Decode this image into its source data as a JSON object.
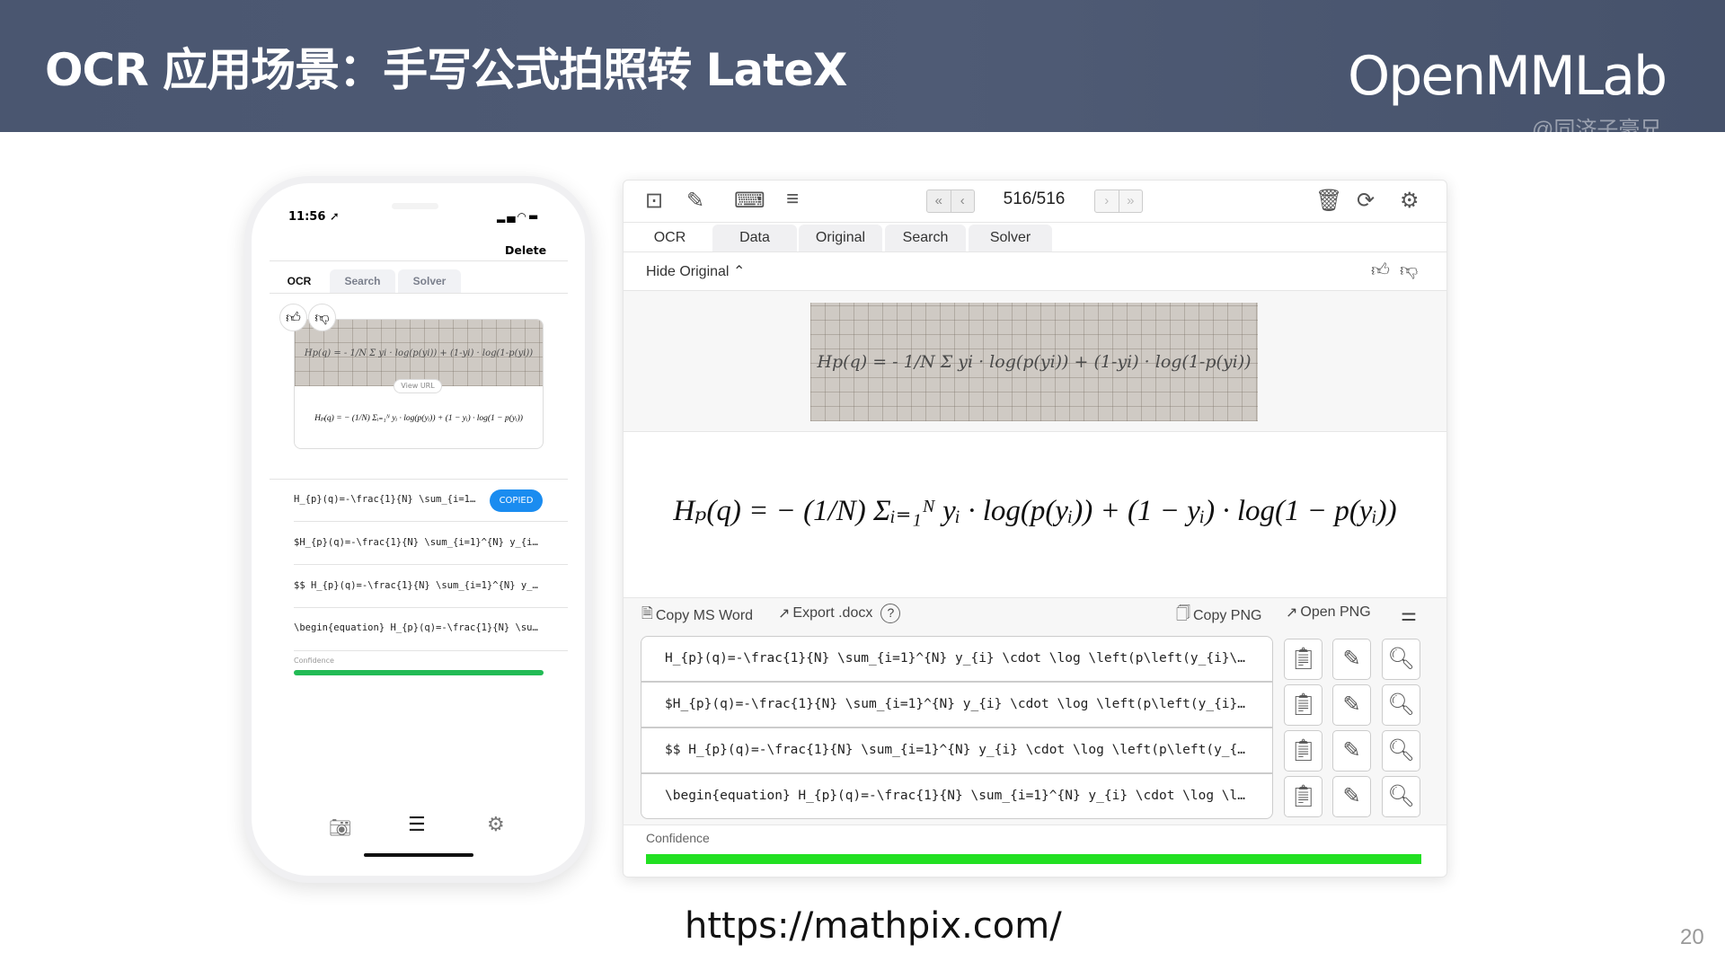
{
  "slide": {
    "title": "OCR 应用场景：手写公式拍照转 LateX",
    "logo": "OpenMMLab",
    "watermark": "@同济子豪兄",
    "url": "https://mathpix.com/",
    "page_number": "20"
  },
  "phone": {
    "time": "11:56",
    "delete_label": "Delete",
    "tabs": [
      {
        "label": "OCR",
        "active": true
      },
      {
        "label": "Search"
      },
      {
        "label": "Solver"
      }
    ],
    "view_url_label": "View URL",
    "handwritten_formula": "Hp(q) = - 1/N Σ yi · log(p(yi)) + (1-yi) · log(1-p(yi))",
    "rendered_formula": "Hₚ(q) = − (1/N) Σᵢ₌₁ᴺ yᵢ · log(p(yᵢ)) + (1 − yᵢ) · log(1 − p(yᵢ))",
    "results": [
      "H_{p}(q)=-\\frac{1}{N} \\sum_{i=1…",
      "$H_{p}(q)=-\\frac{1}{N} \\sum_{i=1}^{N} y_{i…",
      "$$ H_{p}(q)=-\\frac{1}{N} \\sum_{i=1}^{N} y_…",
      "\\begin{equation} H_{p}(q)=-\\frac{1}{N} \\su…"
    ],
    "copied_label": "COPIED",
    "confidence_label": "Confidence",
    "confidence": 1.0,
    "colors": {
      "copied": "#1a8cf0",
      "confidence": "#22bb55"
    }
  },
  "desktop": {
    "counter": "516/516",
    "tabs": [
      {
        "label": "OCR",
        "active": true
      },
      {
        "label": "Data"
      },
      {
        "label": "Original"
      },
      {
        "label": "Search"
      },
      {
        "label": "Solver"
      }
    ],
    "hide_original_label": "Hide Original",
    "actions": {
      "copy_word": "Copy MS Word",
      "export_docx": "Export .docx",
      "copy_png": "Copy PNG",
      "open_png": "Open PNG"
    },
    "results": [
      "H_{p}(q)=-\\frac{1}{N} \\sum_{i=1}^{N} y_{i} \\cdot \\log \\left(p\\left(y_{i}\\…",
      "$H_{p}(q)=-\\frac{1}{N} \\sum_{i=1}^{N} y_{i} \\cdot \\log \\left(p\\left(y_{i}…",
      "$$ H_{p}(q)=-\\frac{1}{N} \\sum_{i=1}^{N} y_{i} \\cdot \\log \\left(p\\left(y_{…",
      "\\begin{equation} H_{p}(q)=-\\frac{1}{N} \\sum_{i=1}^{N} y_{i} \\cdot \\log \\l…"
    ],
    "confidence_label": "Confidence",
    "confidence": 1.0,
    "colors": {
      "confidence": "#22e022"
    }
  }
}
